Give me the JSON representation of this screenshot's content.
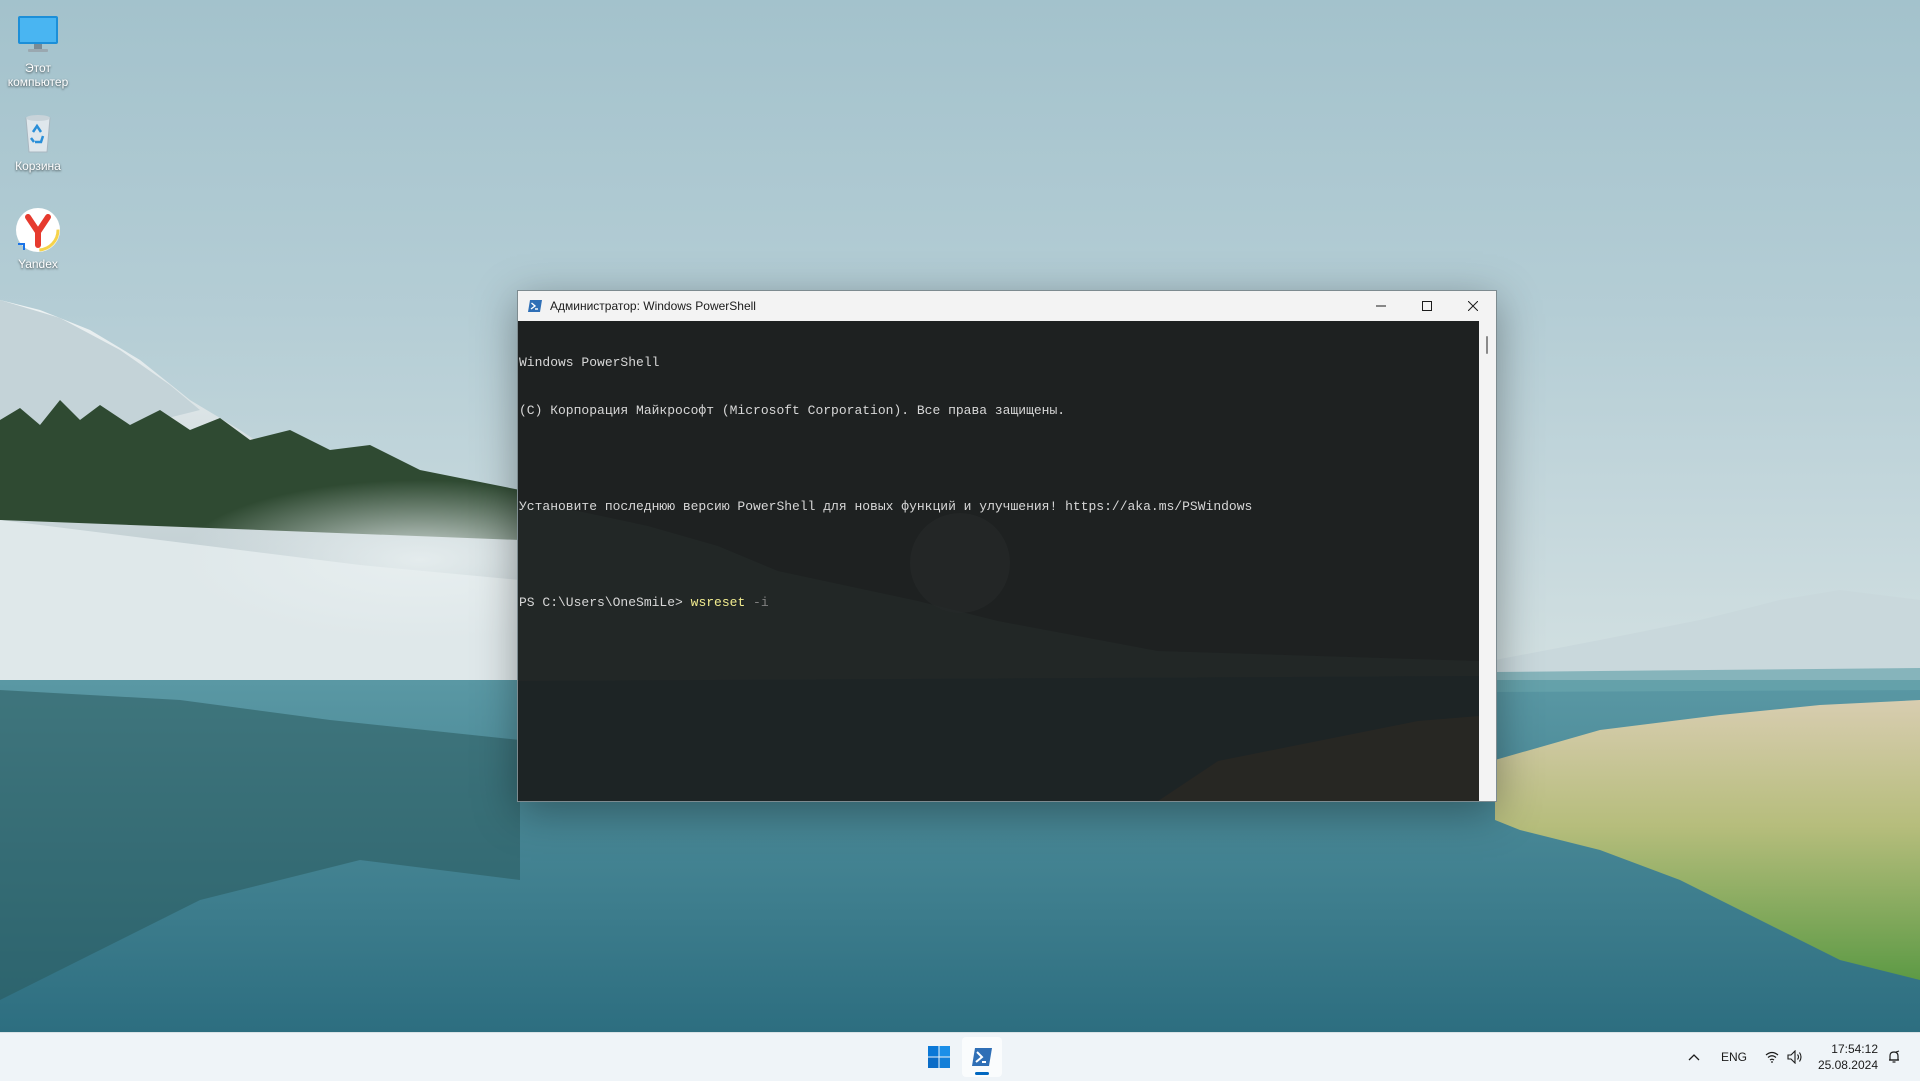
{
  "desktop": {
    "icons": [
      {
        "label": "Этот компьютер",
        "icon": "monitor-icon"
      },
      {
        "label": "Корзина",
        "icon": "recycle-bin-icon"
      },
      {
        "label": "Yandex",
        "icon": "yandex-browser-icon"
      }
    ]
  },
  "window": {
    "title": "Администратор: Windows PowerShell",
    "icon": "powershell-icon",
    "controls": {
      "minimize": "minimize-icon",
      "maximize": "maximize-icon",
      "close": "close-icon"
    },
    "terminal": {
      "line1": "Windows PowerShell",
      "line2": "(C) Корпорация Майкрософт (Microsoft Corporation). Все права защищены.",
      "line3": "Установите последнюю версию PowerShell для новых функций и улучшения! https://aka.ms/PSWindows",
      "prompt": "PS C:\\Users\\OneSmiLe> ",
      "command": "wsreset",
      "argument": " -i"
    }
  },
  "taskbar": {
    "start_icon": "windows-start-icon",
    "pinned": [
      {
        "name": "powershell",
        "icon": "powershell-icon",
        "active": true
      }
    ],
    "tray": {
      "language": "ENG",
      "time": "17:54:12",
      "date": "25.08.2024"
    },
    "colors": {
      "accent": "#0067c0"
    }
  }
}
